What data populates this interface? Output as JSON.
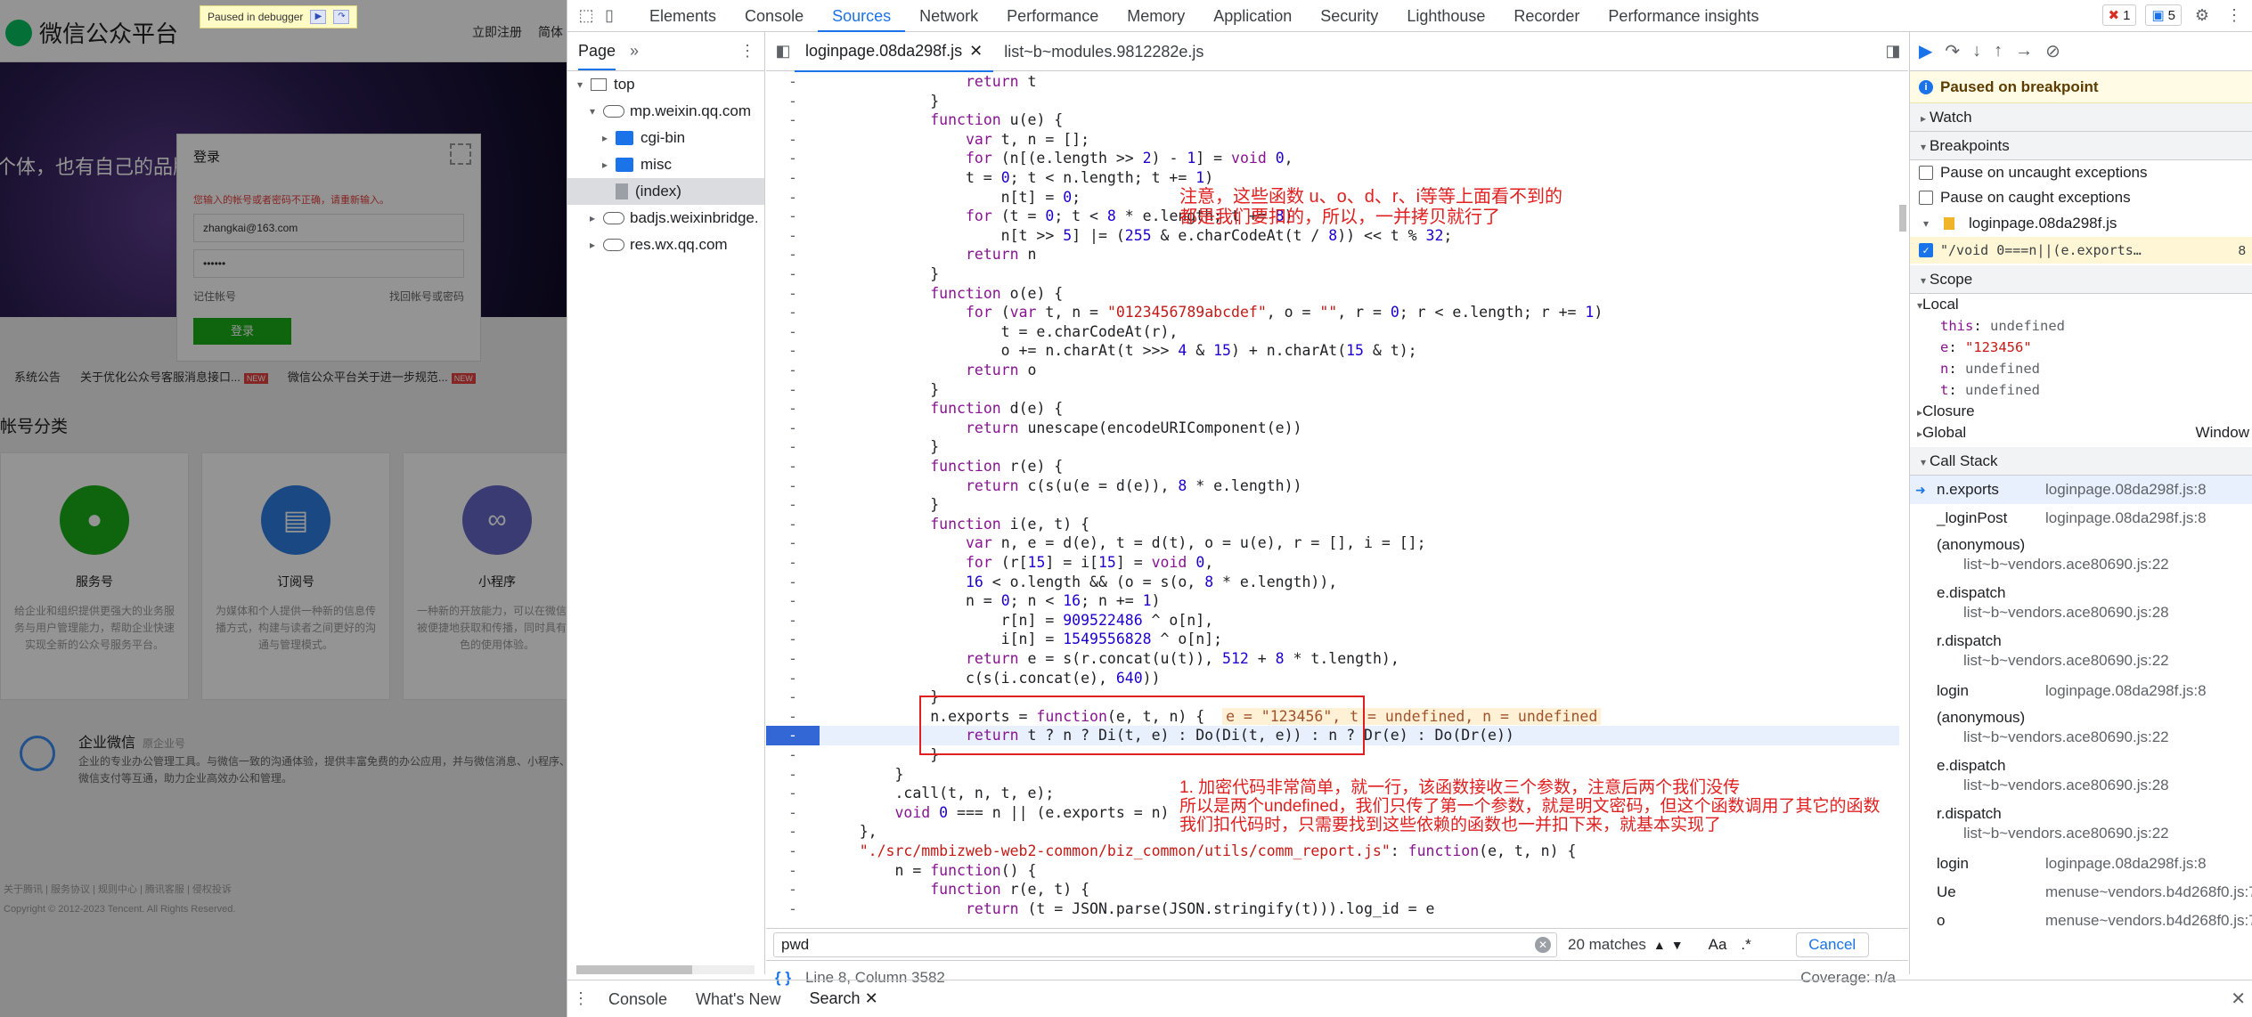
{
  "page": {
    "debugger_banner": "Paused in debugger",
    "logo_text": "微信公众平台",
    "header_links": [
      "立即注册",
      "简体"
    ],
    "banner_slogan": "个体，也有自己的品牌",
    "login": {
      "title": "登录",
      "error": "您输入的帐号或者密码不正确，请重新输入。",
      "account": "zhangkai@163.com",
      "password": "••••••",
      "remember": "记住帐号",
      "forgot": "找回帐号或密码",
      "submit": "登录"
    },
    "notices": [
      {
        "label": "系统公告"
      },
      {
        "label": "关于优化公众号客服消息接口..."
      },
      {
        "label": "微信公众平台关于进一步规范..."
      }
    ],
    "new_badge": "NEW",
    "section_title": "帐号分类",
    "cards": [
      {
        "name": "服务号",
        "desc": "给企业和组织提供更强大的业务服务与用户管理能力，帮助企业快速实现全新的公众号服务平台。",
        "color": "#1aad19",
        "icon": "person-icon"
      },
      {
        "name": "订阅号",
        "desc": "为媒体和个人提供一种新的信息传播方式，构建与读者之间更好的沟通与管理模式。",
        "color": "#2b7de1",
        "icon": "document-icon"
      },
      {
        "name": "小程序",
        "desc": "一种新的开放能力，可以在微信内被便捷地获取和传播，同时具有出色的使用体验。",
        "color": "#6467c7",
        "icon": "link-icon"
      }
    ],
    "enterprise": {
      "title": "企业微信",
      "subtitle": "原企业号",
      "desc": "企业的专业办公管理工具。与微信一致的沟通体验，提供丰富免费的办公应用，并与微信消息、小程序、微信支付等互通，助力企业高效办公和管理。"
    },
    "footer_links": "关于腾讯 | 服务协议 | 规则中心 | 腾讯客服 | 侵权投诉",
    "copyright": "Copyright © 2012-2023 Tencent. All Rights Reserved."
  },
  "devtools": {
    "tabs": [
      "Elements",
      "Console",
      "Sources",
      "Network",
      "Performance",
      "Memory",
      "Application",
      "Security",
      "Lighthouse",
      "Recorder",
      "Performance insights"
    ],
    "active_tab": "Sources",
    "error_count": "1",
    "message_count": "5",
    "navigator": {
      "tab": "Page",
      "tree": [
        {
          "label": "top",
          "type": "frame",
          "indent": 0,
          "open": true
        },
        {
          "label": "mp.weixin.qq.com",
          "type": "cloud",
          "indent": 1,
          "open": true
        },
        {
          "label": "cgi-bin",
          "type": "folder",
          "indent": 2,
          "open": false
        },
        {
          "label": "misc",
          "type": "folder",
          "indent": 2,
          "open": false
        },
        {
          "label": "(index)",
          "type": "file",
          "indent": 2,
          "selected": true
        },
        {
          "label": "badjs.weixinbridge.",
          "type": "cloud",
          "indent": 1,
          "open": false
        },
        {
          "label": "res.wx.qq.com",
          "type": "cloud",
          "indent": 1,
          "open": false
        }
      ]
    },
    "editor_tabs": [
      {
        "label": "loginpage.08da298f.js",
        "active": true
      },
      {
        "label": "list~b~modules.9812282e.js",
        "active": false
      }
    ],
    "code_lines": [
      "                return t",
      "            }",
      "            function u(e) {",
      "                var t, n = [];",
      "                for (n[(e.length >> 2) - 1] = void 0,",
      "                t = 0; t < n.length; t += 1)",
      "                    n[t] = 0;",
      "                for (t = 0; t < 8 * e.length; t += 8)",
      "                    n[t >> 5] |= (255 & e.charCodeAt(t / 8)) << t % 32;",
      "                return n",
      "            }",
      "            function o(e) {",
      "                for (var t, n = \"0123456789abcdef\", o = \"\", r = 0; r < e.length; r += 1)",
      "                    t = e.charCodeAt(r),",
      "                    o += n.charAt(t >>> 4 & 15) + n.charAt(15 & t);",
      "                return o",
      "            }",
      "            function d(e) {",
      "                return unescape(encodeURIComponent(e))",
      "            }",
      "            function r(e) {",
      "                return c(s(u(e = d(e)), 8 * e.length))",
      "            }",
      "            function i(e, t) {",
      "                var n, e = d(e), t = d(t), o = u(e), r = [], i = [];",
      "                for (r[15] = i[15] = void 0,",
      "                16 < o.length && (o = s(o, 8 * e.length)),",
      "                n = 0; n < 16; n += 1)",
      "                    r[n] = 909522486 ^ o[n],",
      "                    i[n] = 1549556828 ^ o[n];",
      "                return e = s(r.concat(u(t)), 512 + 8 * t.length),",
      "                c(s(i.concat(e), 640))",
      "            }",
      "            n.exports = function(e, t, n) {",
      "                return t ? n ? Di(t, e) : Do(Di(t, e)) : n ? Dr(e) : Do(Dr(e))",
      "            }",
      "        }",
      "        .call(t, n, t, e);",
      "        void 0 === n || (e.exports = n)",
      "    },",
      "    \"./src/mmbizweb-web2-common/biz_common/utils/comm_report.js\": function(e, t, n) {",
      "        n = function() {",
      "            function r(e, t) {",
      "                return (t = JSON.parse(JSON.stringify(t))).log_id = e"
    ],
    "inline_value": "e = \"123456\", t = undefined, n = undefined",
    "annotation_top": "注意，这些函数 u、o、d、r、i等等上面看不到的\n都是我们要扣的，所以，一并拷贝就行了",
    "annotation_bottom": "1. 加密代码非常简单，就一行，该函数接收三个参数，注意后两个我们没传\n所以是两个undefined，我们只传了第一个参数，就是明文密码，但这个函数调用了其它的函数\n我们扣代码时，只需要找到这些依赖的函数也一并扣下来，就基本实现了",
    "search": {
      "query": "pwd",
      "matches": "20 matches",
      "case_label": "Aa",
      "regex_label": ".*",
      "cancel": "Cancel"
    },
    "status": {
      "position": "Line 8, Column 3582",
      "coverage": "Coverage: n/a"
    },
    "debugger": {
      "paused_text": "Paused on breakpoint",
      "watch": "Watch",
      "breakpoints": "Breakpoints",
      "pause_uncaught": "Pause on uncaught exceptions",
      "pause_caught": "Pause on caught exceptions",
      "bp_file": "loginpage.08da298f.js",
      "bp_code": "\"/void 0===n||(e.exports…",
      "bp_line": "8",
      "scope": "Scope",
      "local": "Local",
      "scope_vars": [
        {
          "key": "this",
          "value": "undefined",
          "type": "v"
        },
        {
          "key": "e",
          "value": "\"123456\"",
          "type": "s"
        },
        {
          "key": "n",
          "value": "undefined",
          "type": "v"
        },
        {
          "key": "t",
          "value": "undefined",
          "type": "v"
        }
      ],
      "closure": "Closure",
      "global": "Global",
      "global_val": "Window",
      "call_stack": "Call Stack",
      "frames": [
        {
          "fn": "n.exports",
          "loc": "loginpage.08da298f.js:8",
          "two": false,
          "active": true
        },
        {
          "fn": "_loginPost",
          "loc": "loginpage.08da298f.js:8",
          "two": false
        },
        {
          "fn": "(anonymous)",
          "loc": "list~b~vendors.ace80690.js:22",
          "two": true
        },
        {
          "fn": "e.dispatch",
          "loc": "list~b~vendors.ace80690.js:28",
          "two": true
        },
        {
          "fn": "r.dispatch",
          "loc": "list~b~vendors.ace80690.js:22",
          "two": true
        },
        {
          "fn": "login",
          "loc": "loginpage.08da298f.js:8",
          "two": false
        },
        {
          "fn": "(anonymous)",
          "loc": "list~b~vendors.ace80690.js:22",
          "two": true
        },
        {
          "fn": "e.dispatch",
          "loc": "list~b~vendors.ace80690.js:28",
          "two": true
        },
        {
          "fn": "r.dispatch",
          "loc": "list~b~vendors.ace80690.js:22",
          "two": true
        },
        {
          "fn": "login",
          "loc": "loginpage.08da298f.js:8",
          "two": false
        },
        {
          "fn": "Ue",
          "loc": "menuse~vendors.b4d268f0.js:7",
          "two": false
        },
        {
          "fn": "o",
          "loc": "menuse~vendors.b4d268f0.js:7",
          "two": false
        }
      ]
    },
    "drawer_tabs": [
      "Console",
      "What's New",
      "Search"
    ],
    "drawer_active": "Search"
  }
}
